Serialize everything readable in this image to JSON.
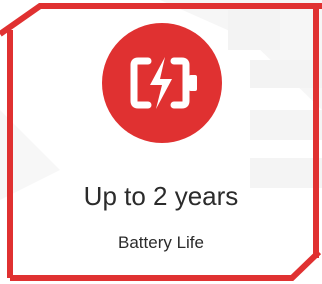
{
  "feature": {
    "value_text": "Up to 2 years",
    "label_text": "Battery Life",
    "icon": "battery-charging-icon"
  },
  "colors": {
    "accent": "#e03131",
    "text": "#2b2b2b",
    "background": "#ffffff",
    "watermark": "#f2f2f2"
  }
}
